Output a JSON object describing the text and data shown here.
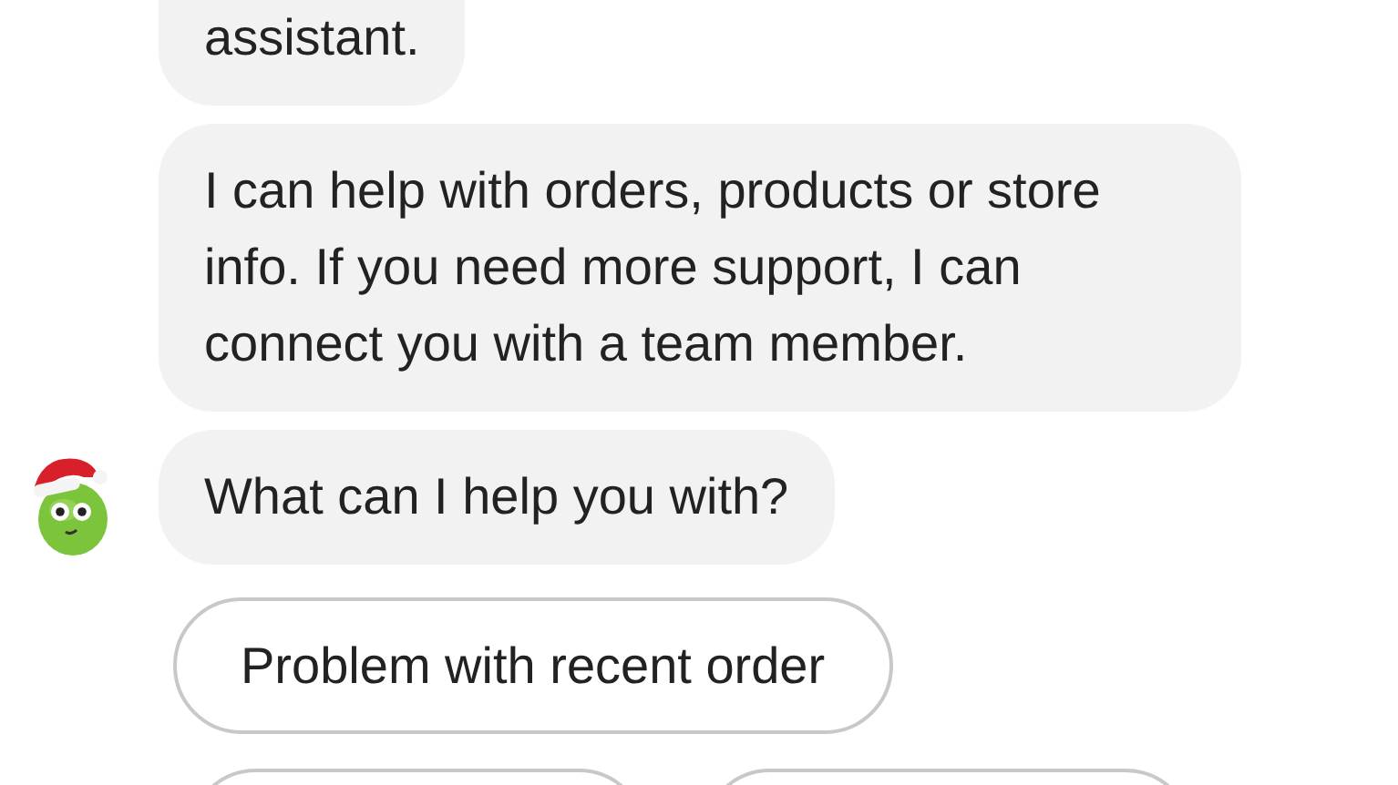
{
  "messages": [
    {
      "text": "assistant.",
      "cut_top": true,
      "avatar": false
    },
    {
      "text": "I can help with orders, products or store info. If you need more support, I can connect you with a team member.",
      "cut_top": false,
      "avatar": false
    },
    {
      "text": "What can I help you with?",
      "cut_top": false,
      "avatar": true
    }
  ],
  "quick_replies": [
    {
      "kind": "full",
      "label": "Problem with recent order"
    },
    {
      "kind": "cut_off"
    },
    {
      "kind": "cut_off"
    }
  ]
}
